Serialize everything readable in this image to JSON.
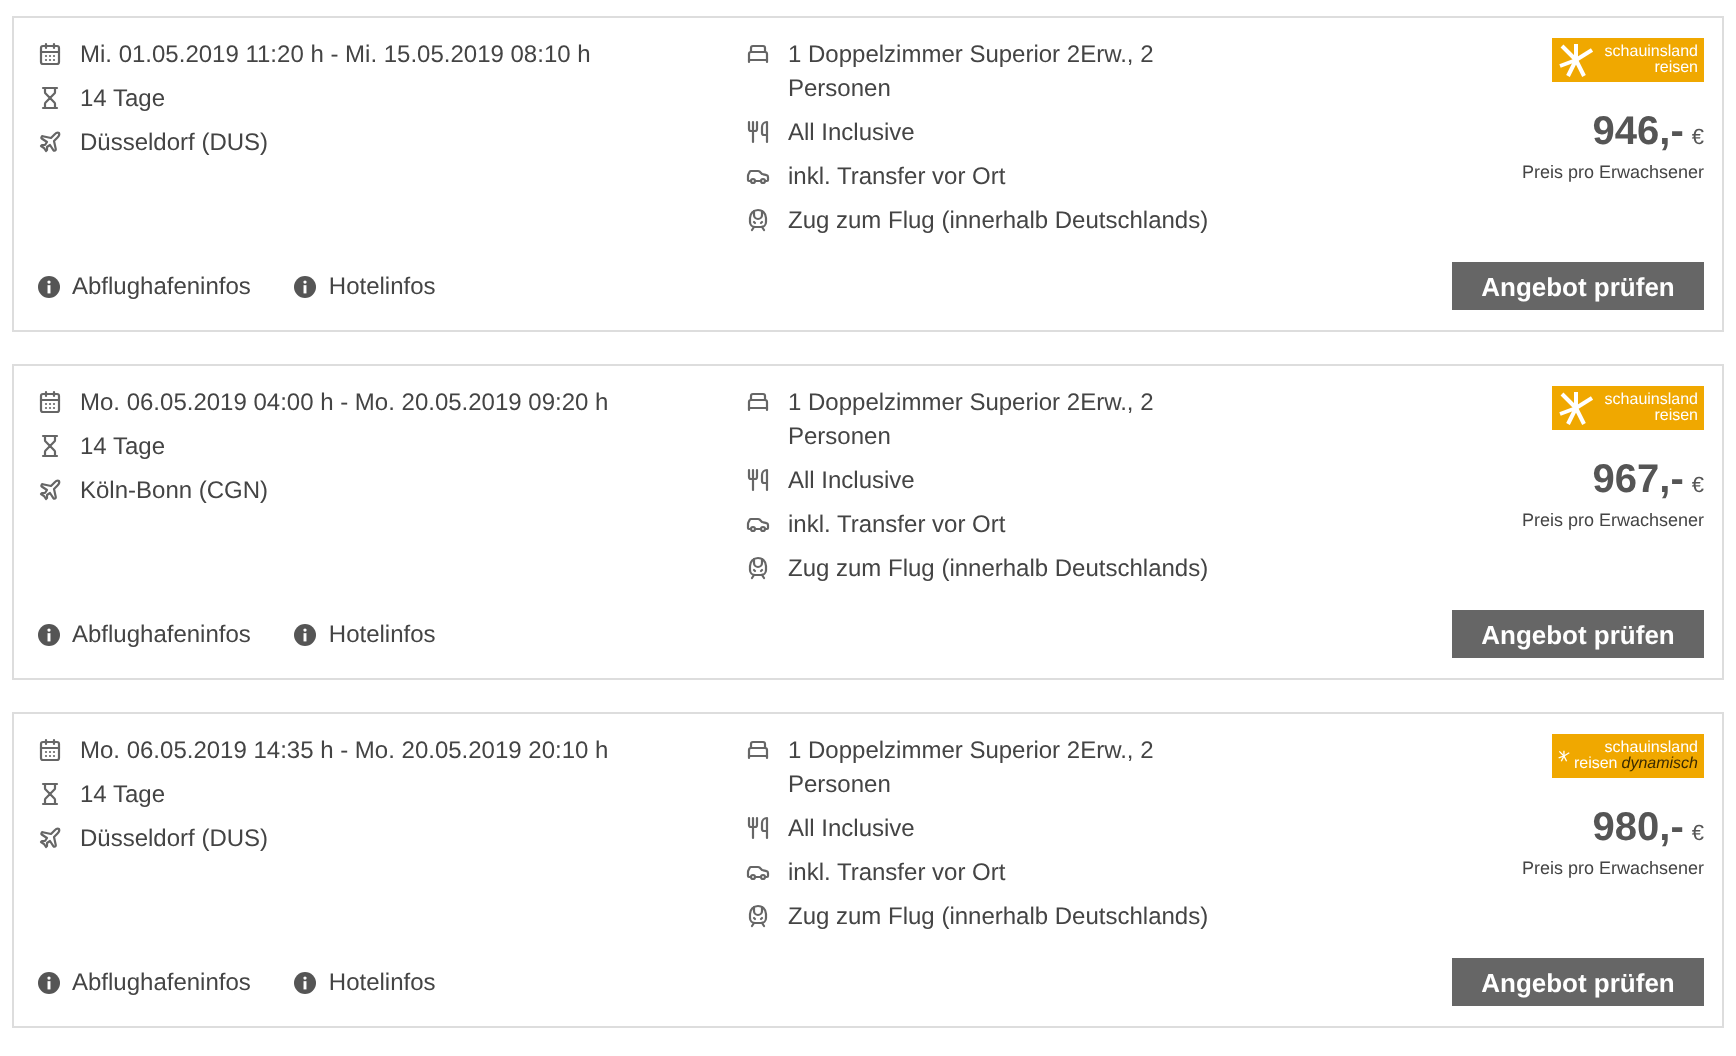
{
  "offers": [
    {
      "dates": "Mi. 01.05.2019 11:20 h - Mi. 15.05.2019 08:10 h",
      "duration": "14 Tage",
      "airport": "Düsseldorf (DUS)",
      "room": "1 Doppelzimmer Superior 2Erw., 2 Personen",
      "board": "All Inclusive",
      "transfer": "inkl. Transfer vor Ort",
      "train": "Zug zum Flug (innerhalb Deutschlands)",
      "logo": {
        "line1": "schauinsland",
        "line2": "reisen"
      },
      "price": "946,-",
      "currency": "€",
      "price_note": "Preis pro Erwachsener",
      "links": [
        "Abflughafeninfos",
        "Hotelinfos"
      ],
      "button": "Angebot prüfen"
    },
    {
      "dates": "Mo. 06.05.2019 04:00 h - Mo. 20.05.2019 09:20 h",
      "duration": "14 Tage",
      "airport": "Köln-Bonn (CGN)",
      "room": "1 Doppelzimmer Superior 2Erw., 2 Personen",
      "board": "All Inclusive",
      "transfer": "inkl. Transfer vor Ort",
      "train": "Zug zum Flug (innerhalb Deutschlands)",
      "logo": {
        "line1": "schauinsland",
        "line2": "reisen"
      },
      "price": "967,-",
      "currency": "€",
      "price_note": "Preis pro Erwachsener",
      "links": [
        "Abflughafeninfos",
        "Hotelinfos"
      ],
      "button": "Angebot prüfen"
    },
    {
      "dates": "Mo. 06.05.2019 14:35 h - Mo. 20.05.2019 20:10 h",
      "duration": "14 Tage",
      "airport": "Düsseldorf (DUS)",
      "room": "1 Doppelzimmer Superior 2Erw., 2 Personen",
      "board": "All Inclusive",
      "transfer": "inkl. Transfer vor Ort",
      "train": "Zug zum Flug (innerhalb Deutschlands)",
      "logo": {
        "line1": "schauinsland",
        "line2": "reisen",
        "extra": "dynamisch"
      },
      "price": "980,-",
      "currency": "€",
      "price_note": "Preis pro Erwachsener",
      "links": [
        "Abflughafeninfos",
        "Hotelinfos"
      ],
      "button": "Angebot prüfen"
    }
  ]
}
